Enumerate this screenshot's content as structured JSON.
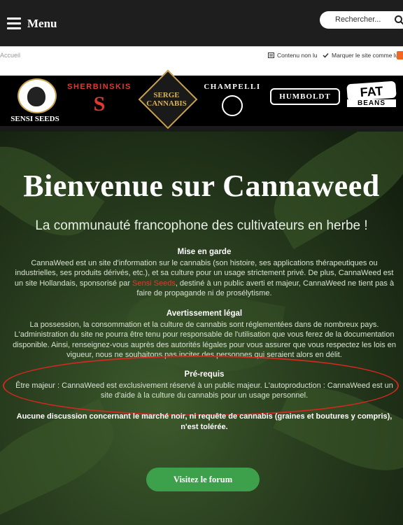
{
  "topbar": {
    "menu_label": "Menu",
    "search_placeholder": "Rechercher..."
  },
  "breadcrumb": {
    "label": "Accueil",
    "action_unread": "Contenu non lu",
    "action_mark_read": "Marquer le site comme lu"
  },
  "sponsors": {
    "sensi": "SENSI SEEDS",
    "sherbinskis": "SHERBINSKIS",
    "sherbinskis_logo": "S",
    "serge": "SERGE CANNABIS",
    "champelli": "CHAMPELLI",
    "humboldt": "HUMBOLDT",
    "fat": "FAT",
    "fat_sub": "BEANS"
  },
  "hero": {
    "title": "Bienvenue sur Cannaweed",
    "subtitle": "La communauté francophone des cultivateurs en herbe !",
    "mise_en_garde_title": "Mise en garde",
    "mise_en_garde_text_before": "CannaWeed est un site d'information sur le cannabis (son histoire, ses applications thérapeutiques ou industrielles, ses produits dérivés, etc.), et sa culture pour un usage strictement privé. De plus, CannaWeed est un site Hollandais, sponsorisé par ",
    "mise_en_garde_link": "Sensi Seeds",
    "mise_en_garde_text_after": ", destiné à un public averti et majeur, CannaWeed ne tient pas à faire de propagande ni de prosélytisme.",
    "avertissement_title": "Avertissement légal",
    "avertissement_text": "La possession, la consommation et la culture de cannabis sont réglementées dans de nombreux pays. L'administration du site ne pourra être tenu pour responsable de l'utilisation que vous ferez de la documentation disponible. Ainsi, renseignez-vous auprès des autorités légales pour vous assurer que vous respectez les lois en vigueur, nous ne souhaitons pas inciter des personnes qui seraient alors en délit.",
    "prerequis_title": "Pré-requis",
    "prerequis_text": "Être majeur : CannaWeed est exclusivement réservé à un public majeur. L'autoproduction : CannaWeed est un site d'aide à la culture du cannabis pour un usage personnel.",
    "warning": "Aucune discussion concernant le marché noir, ni requête de cannabis (graines et boutures y compris), n'est tolérée.",
    "forum_button": "Visitez le forum"
  },
  "colors": {
    "accent_red": "#e03a2f",
    "button_green": "#3da04a",
    "annotation_ellipse": "#d2281f"
  }
}
